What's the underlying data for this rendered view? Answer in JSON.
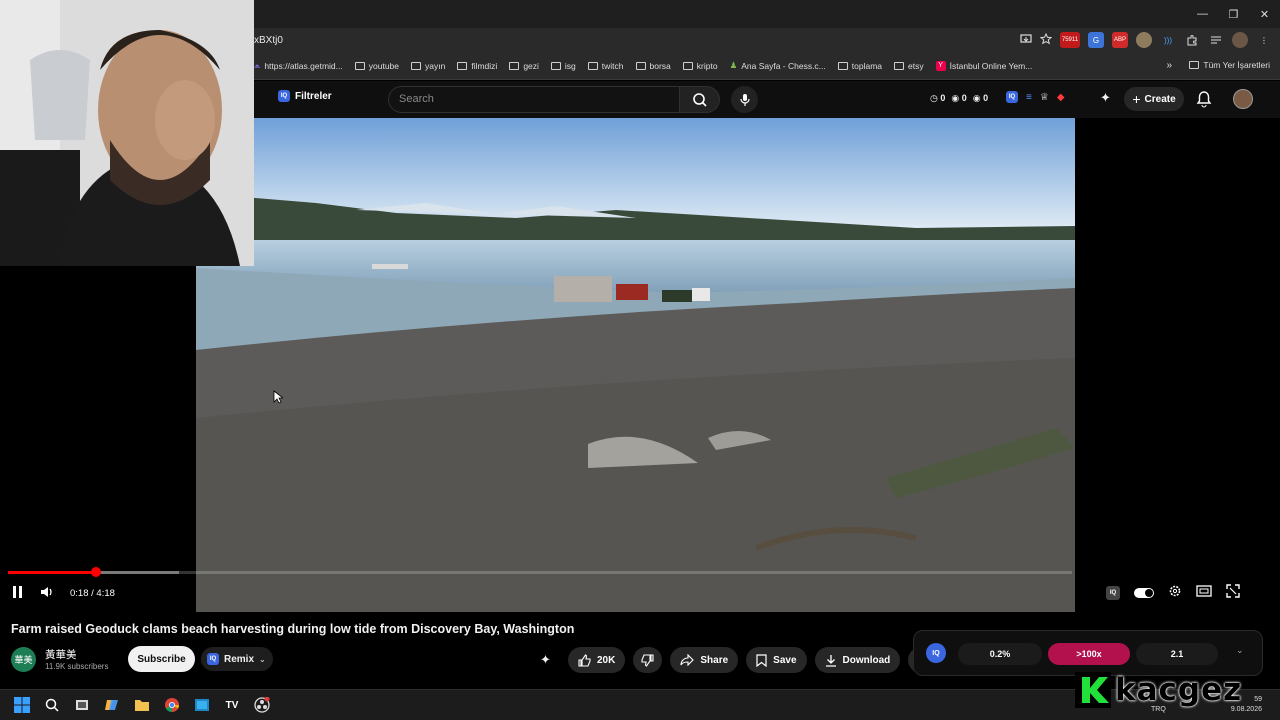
{
  "browser": {
    "url_fragment": "xBXtj0",
    "badge_count": "75911",
    "bookmarks": [
      {
        "label": "https://atlas.getmid...",
        "kind": "link"
      },
      {
        "label": "youtube",
        "kind": "folder"
      },
      {
        "label": "yayın",
        "kind": "folder"
      },
      {
        "label": "filmdizi",
        "kind": "folder"
      },
      {
        "label": "gezi",
        "kind": "folder"
      },
      {
        "label": "isg",
        "kind": "folder"
      },
      {
        "label": "twitch",
        "kind": "folder"
      },
      {
        "label": "borsa",
        "kind": "folder"
      },
      {
        "label": "kripto",
        "kind": "folder"
      },
      {
        "label": "Ana Sayfa - Chess.c...",
        "kind": "link"
      },
      {
        "label": "toplama",
        "kind": "folder"
      },
      {
        "label": "etsy",
        "kind": "folder"
      },
      {
        "label": "İstanbul Online Yem...",
        "kind": "link"
      }
    ],
    "all_bookmarks_label": "Tüm Yer İşaretleri"
  },
  "header": {
    "filters_label": "Filtreler",
    "search_placeholder": "Search",
    "counters": [
      "0",
      "0",
      "0"
    ],
    "create_label": "Create"
  },
  "player": {
    "time_current": "0:18",
    "time_total": "4:18",
    "time_display": "0:18 / 4:18",
    "played_fraction": 0.0827,
    "buffered_fraction": 0.1608
  },
  "video": {
    "title": "Farm raised Geoduck clams beach harvesting during low tide from Discovery Bay, Washington",
    "channel_name": "黃華美",
    "channel_avatar_text": "華美",
    "subscribers": "11.9K subscribers",
    "subscribe_label": "Subscribe",
    "remix_label": "Remix",
    "likes": "20K",
    "share_label": "Share",
    "save_label": "Save",
    "download_label": "Download"
  },
  "stats_panel": {
    "badge": "IQ",
    "values": [
      "0.2%",
      ">100x",
      "2.1"
    ]
  },
  "taskbar": {
    "language": "TRQ",
    "date": "9.08.2026",
    "time_partial": "59"
  },
  "overlay_logo": {
    "text": "kacgez"
  },
  "colors": {
    "accent_red": "#ff0000",
    "hot_pill": "#b3114e",
    "iq_blue": "#3a66e0"
  }
}
